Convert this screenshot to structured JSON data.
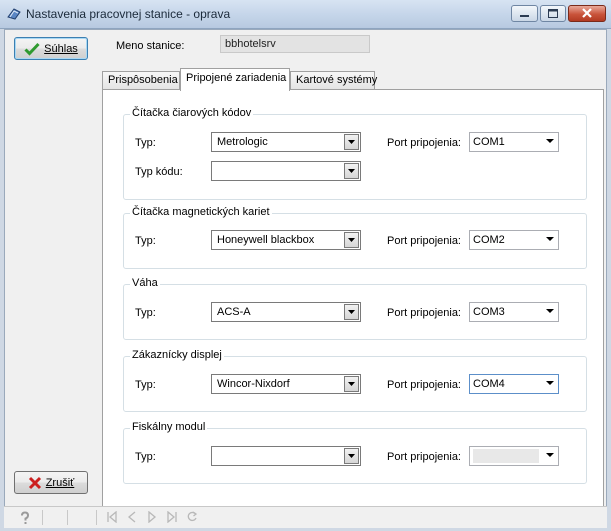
{
  "window": {
    "title": "Nastavenia pracovnej stanice - oprava"
  },
  "actions": {
    "ok_label": "Súhlas",
    "cancel_label": "Zrušiť"
  },
  "header": {
    "meno_label": "Meno stanice:",
    "meno_value": "bbhotelsrv"
  },
  "tabs": [
    {
      "label": "Prispôsobenia",
      "active": false
    },
    {
      "label": "Pripojené zariadenia",
      "active": true
    },
    {
      "label": "Kartové systémy",
      "active": false
    }
  ],
  "groups": {
    "barcode": {
      "title": "Čítačka čiarových kódov",
      "typ_label": "Typ:",
      "typ_value": "Metrologic",
      "typkodu_label": "Typ kódu:",
      "typkodu_value": "",
      "port_label": "Port pripojenia:",
      "port_value": "COM1"
    },
    "magnetic": {
      "title": "Čítačka magnetických kariet",
      "typ_label": "Typ:",
      "typ_value": "Honeywell blackbox",
      "port_label": "Port pripojenia:",
      "port_value": "COM2"
    },
    "scale": {
      "title": "Váha",
      "typ_label": "Typ:",
      "typ_value": "ACS-A",
      "port_label": "Port pripojenia:",
      "port_value": "COM3"
    },
    "display": {
      "title": "Zákaznícky displej",
      "typ_label": "Typ:",
      "typ_value": "Wincor-Nixdorf",
      "port_label": "Port pripojenia:",
      "port_value": "COM4"
    },
    "fiscal": {
      "title": "Fiskálny modul",
      "typ_label": "Typ:",
      "typ_value": "",
      "port_label": "Port pripojenia:",
      "port_value": ""
    }
  },
  "statusbar": {
    "help_icon": "question-icon",
    "nav_icons": [
      "first-icon",
      "prev-icon",
      "next-icon",
      "last-icon",
      "refresh-icon"
    ]
  },
  "colors": {
    "titlebar": "#c6d6ea",
    "close_button": "#c9543b",
    "ok_check": "#2f9a2f",
    "cancel_x": "#cc2020"
  }
}
